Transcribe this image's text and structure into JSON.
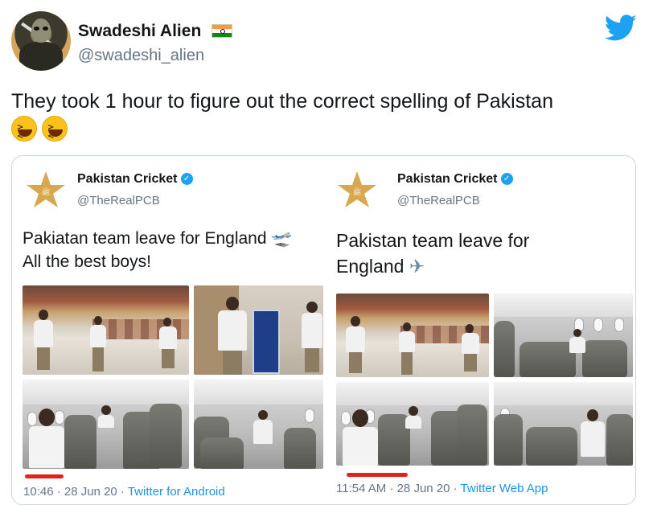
{
  "outer_tweet": {
    "display_name": "Swadeshi Alien",
    "handle": "@swadeshi_alien",
    "text": "They took 1 hour to figure out the correct spelling of Pakistan",
    "icons": [
      "avatar-icon",
      "india-flag-icon",
      "twitter-bird-icon",
      "laughing-emoji-icon",
      "laughing-emoji-icon"
    ],
    "colors": {
      "brand": "#1da1f2",
      "text": "#14171a",
      "muted": "#657786"
    }
  },
  "left_tweet": {
    "display_name": "Pakistan Cricket",
    "handle": "@TheRealPCB",
    "text_line1": "Pakiatan team leave for England",
    "text_line2": "All the best boys!",
    "time": "10:46 · 28 Jun 20 · ",
    "source": "Twitter for Android",
    "icons": [
      "pcb-star-logo-icon",
      "verified-badge-icon",
      "airplane-departure-icon"
    ]
  },
  "right_tweet": {
    "display_name": "Pakistan Cricket",
    "handle": "@TheRealPCB",
    "text_line1": "Pakistan team leave for",
    "text_line2": "England",
    "time": "11:54 AM · 28 Jun 20 · ",
    "source": "Twitter Web App",
    "icons": [
      "pcb-star-logo-icon",
      "verified-badge-icon",
      "airplane-icon"
    ]
  },
  "annotation_color": "#e0241b"
}
